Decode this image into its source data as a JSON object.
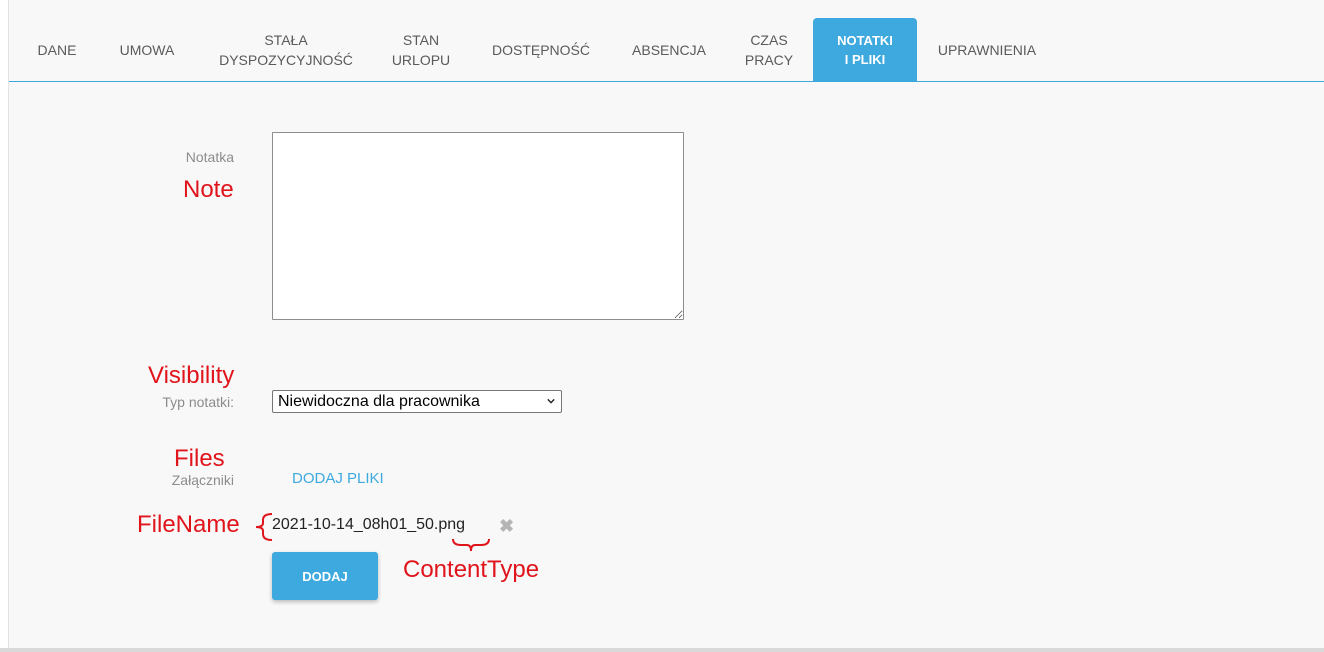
{
  "tabs": [
    {
      "label": "DANE"
    },
    {
      "label": "UMOWA"
    },
    {
      "label": "STAŁA\nDYSPOZYCYJNOŚĆ"
    },
    {
      "label": "STAN\nURLOPU"
    },
    {
      "label": "DOSTĘPNOŚĆ"
    },
    {
      "label": "ABSENCJA"
    },
    {
      "label": "CZAS\nPRACY"
    },
    {
      "label": "NOTATKI\nI PLIKI",
      "active": true
    },
    {
      "label": "UPRAWNIENIA"
    }
  ],
  "form": {
    "note_label": "Notatka",
    "note_value": "",
    "type_label": "Typ notatki:",
    "type_selected": "Niewidoczna dla pracownika",
    "attachments_label": "Załączniki",
    "add_files_link": "DODAJ PLIKI",
    "file_name": "2021-10-14_08h01_50.png",
    "submit_label": "DODAJ"
  },
  "annotations": {
    "note": "Note",
    "visibility": "Visibility",
    "files": "Files",
    "file_name": "FileName",
    "content_type": "ContentType",
    "color": "#e0141b"
  },
  "icons": {
    "remove": "close-icon",
    "select_arrow": "chevron-down-icon"
  },
  "colors": {
    "accent": "#3ea9de",
    "annotation": "#e0141b"
  }
}
